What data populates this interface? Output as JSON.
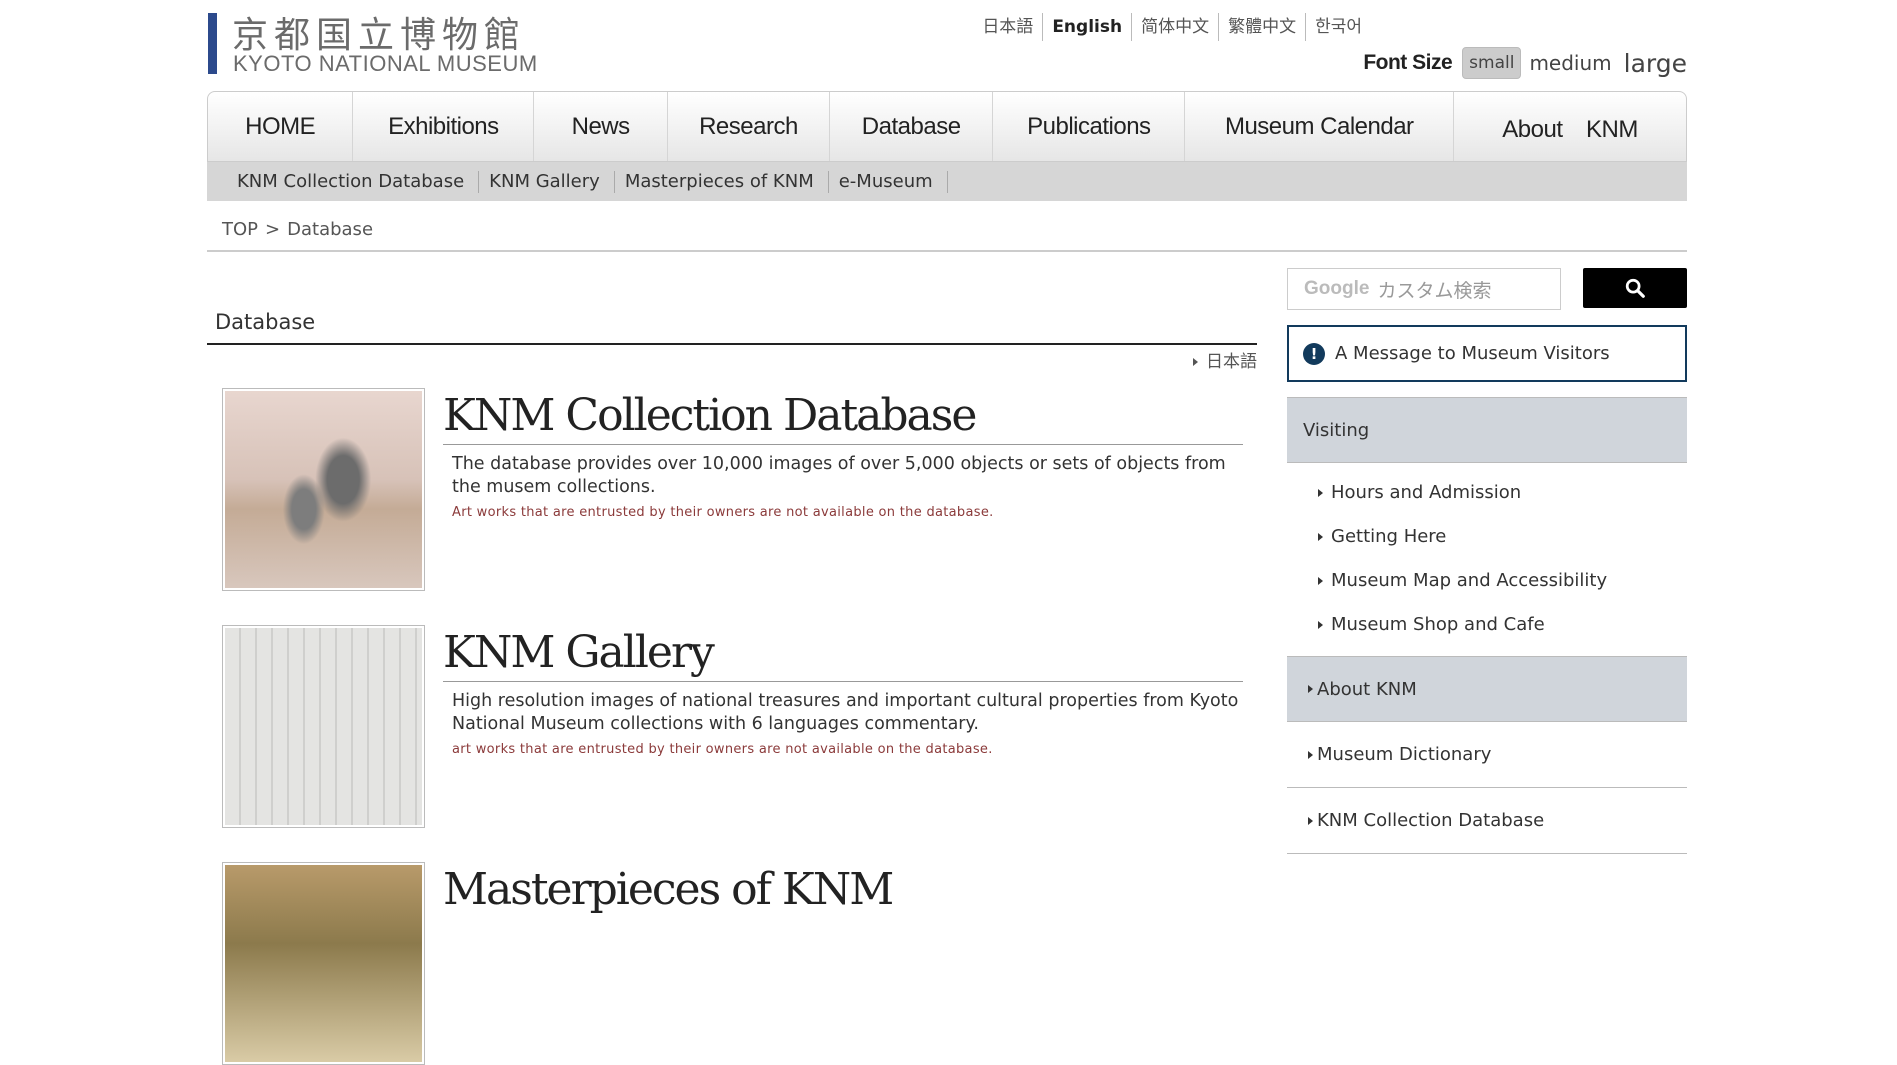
{
  "logo": {
    "jp": "京都国立博物館",
    "en": "KYOTO NATIONAL MUSEUM"
  },
  "languages": [
    "日本語",
    "English",
    "简体中文",
    "繁體中文",
    "한국어"
  ],
  "font_size": {
    "label": "Font Size",
    "small": "small",
    "medium": "medium",
    "large": "large"
  },
  "nav": [
    "HOME",
    "Exhibitions",
    "News",
    "Research",
    "Database",
    "Publications",
    "Museum Calendar",
    "About　KNM"
  ],
  "subnav": [
    "KNM Collection Database",
    "KNM Gallery",
    "Masterpieces of KNM",
    "e-Museum"
  ],
  "breadcrumb": {
    "top": "TOP",
    "sep": ">",
    "current": "Database"
  },
  "main": {
    "title": "Database",
    "jp_link": "日本語",
    "entries": [
      {
        "title": "KNM Collection Database",
        "desc": "The database provides over 10,000 images of over 5,000 objects or sets of objects from the musem collections.",
        "note": "Art works that are entrusted by their owners are not available on the database."
      },
      {
        "title": "KNM Gallery",
        "desc": "High resolution images of national treasures and important cultural properties from Kyoto National Museum collections with 6 languages commentary.",
        "note": "art works that are entrusted by their owners are not available on the database."
      },
      {
        "title": "Masterpieces of KNM"
      }
    ]
  },
  "sidebar": {
    "search_google": "Google",
    "search_placeholder": "カスタム検索",
    "message": "A Message to Museum Visitors",
    "visiting": "Visiting",
    "visiting_items": [
      "Hours and Admission",
      "Getting Here",
      "Museum Map and Accessibility",
      "Museum Shop and Cafe"
    ],
    "about": "About KNM",
    "links": [
      "Museum Dictionary",
      "KNM Collection Database"
    ]
  },
  "colors": {
    "logo_accent": "#2c4a8c",
    "note_red": "#8b3a3a",
    "message_border": "#123a5c",
    "sidebar_head_bg": "#d0d5db"
  }
}
